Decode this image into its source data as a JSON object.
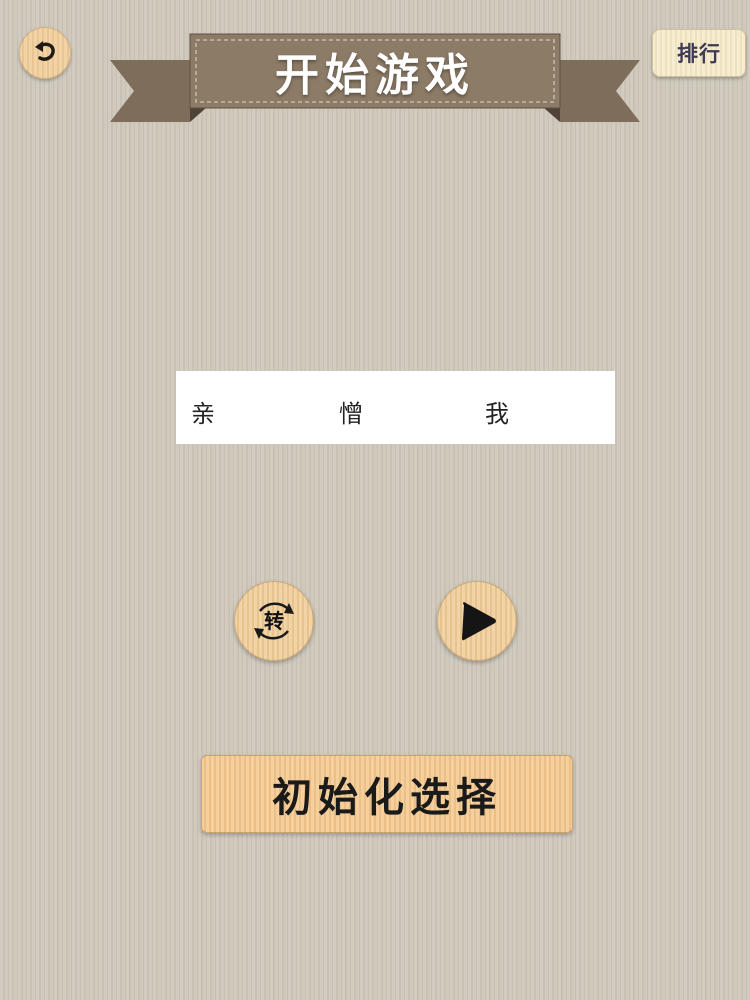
{
  "header": {
    "title": "开始游戏",
    "back_icon": "back-arrow-icon",
    "rank_label": "排行"
  },
  "words": [
    {
      "text": "亲"
    },
    {
      "text": "憎"
    },
    {
      "text": "我"
    }
  ],
  "controls": {
    "rotate_label": "转",
    "rotate_icon": "rotate-icon",
    "play_icon": "play-icon"
  },
  "init_button": {
    "label": "初始化选择"
  },
  "colors": {
    "background": "#cfc9bd",
    "button_wood": "#f2d3a6",
    "ribbon": "#8c7b66"
  }
}
